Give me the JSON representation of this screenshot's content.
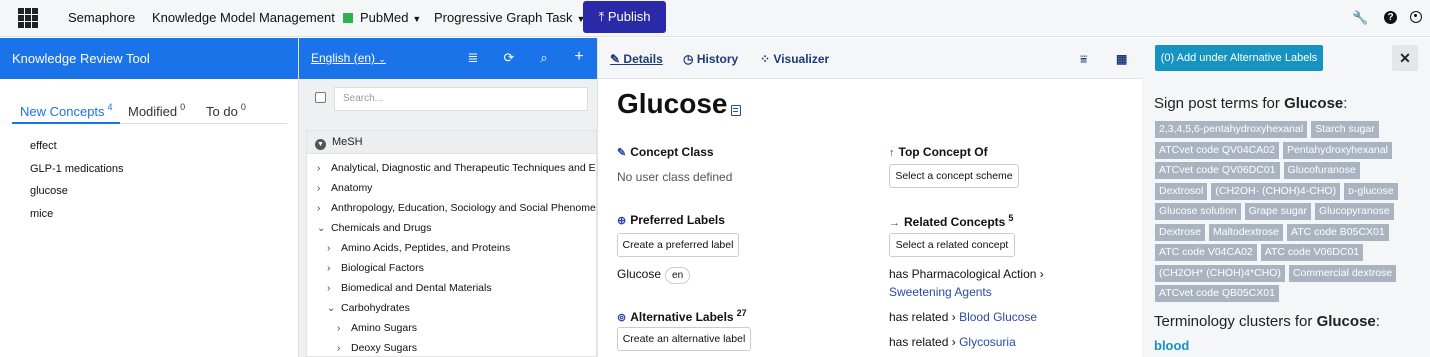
{
  "topbar": {
    "app_name": "Semaphore",
    "module": "Knowledge Model Management",
    "project": "PubMed",
    "task": "Progressive Graph Task",
    "publish_label": "Publish",
    "tools_icon": "wrench-icon",
    "help_icon": "help-icon",
    "user_icon": "user-icon"
  },
  "review": {
    "title": "Knowledge Review Tool",
    "tabs": [
      {
        "label": "New Concepts",
        "count": "4"
      },
      {
        "label": "Modified",
        "count": "0"
      },
      {
        "label": "To do",
        "count": "0"
      }
    ],
    "items": [
      "effect",
      "GLP-1 medications",
      "glucose",
      "mice"
    ]
  },
  "tree": {
    "language": "English (en)",
    "search_placeholder": "Search...",
    "root": "MeSH",
    "nodes": [
      {
        "label": "Analytical, Diagnostic and Therapeutic Techniques and Equip",
        "arrow": "›"
      },
      {
        "label": "Anatomy",
        "arrow": "›"
      },
      {
        "label": "Anthropology, Education, Sociology and Social Phenomena",
        "arrow": "›"
      },
      {
        "label": "Chemicals and Drugs",
        "arrow": "⌄"
      },
      {
        "label": "Amino Acids, Peptides, and Proteins",
        "arrow": "›"
      },
      {
        "label": "Biological Factors",
        "arrow": "›"
      },
      {
        "label": "Biomedical and Dental Materials",
        "arrow": "›"
      },
      {
        "label": "Carbohydrates",
        "arrow": "⌄"
      },
      {
        "label": "Amino Sugars",
        "arrow": "›"
      },
      {
        "label": "Deoxy Sugars",
        "arrow": "›"
      }
    ]
  },
  "details": {
    "tabs": {
      "details": "Details",
      "history": "History",
      "visualizer": "Visualizer"
    },
    "title": "Glucose",
    "concept_class": {
      "heading": "Concept Class",
      "value": "No user class defined"
    },
    "top_concept": {
      "heading": "Top Concept Of",
      "button": "Select a concept scheme"
    },
    "preferred": {
      "heading": "Preferred Labels",
      "button": "Create a preferred label",
      "label": "Glucose",
      "lang": "en"
    },
    "related": {
      "heading": "Related Concepts",
      "count": "5",
      "button": "Select a related concept",
      "rows": [
        {
          "relation": "has Pharmacological Action",
          "target": "Sweetening Agents"
        },
        {
          "relation": "has related",
          "target": "Blood Glucose"
        },
        {
          "relation": "has related",
          "target": "Glycosuria"
        }
      ]
    },
    "alternative": {
      "heading": "Alternative Labels",
      "count": "27",
      "button": "Create an alternative label"
    }
  },
  "signpost": {
    "add_button": "(0) Add under Alternative Labels",
    "close": "✕",
    "heading_prefix": "Sign post terms for ",
    "concept": "Glucose",
    "suffix": ":",
    "terms": [
      "2,3,4,5,6-pentahydroxyhexanal",
      "Starch sugar",
      "ATCvet code QV04CA02",
      "Pentahydroxyhexanal",
      "ATCvet code QV06DC01",
      "Glucofuranose",
      "Dextrosol",
      "(CH2OH· (CHOH)4-CHO)",
      "ᴅ-glucose",
      "Glucose solution",
      "Grape sugar",
      "Glucopyranose",
      "Dextrose",
      "Maltodextrose",
      "ATC code B05CX01",
      "ATC code V04CA02",
      "ATC code V06DC01",
      "(CH2OH* (CHOH)4*CHO)",
      "Commercial dextrose",
      "ATCvet code QB05CX01"
    ],
    "clusters_prefix": "Terminology clusters for ",
    "cluster_item": "blood"
  }
}
